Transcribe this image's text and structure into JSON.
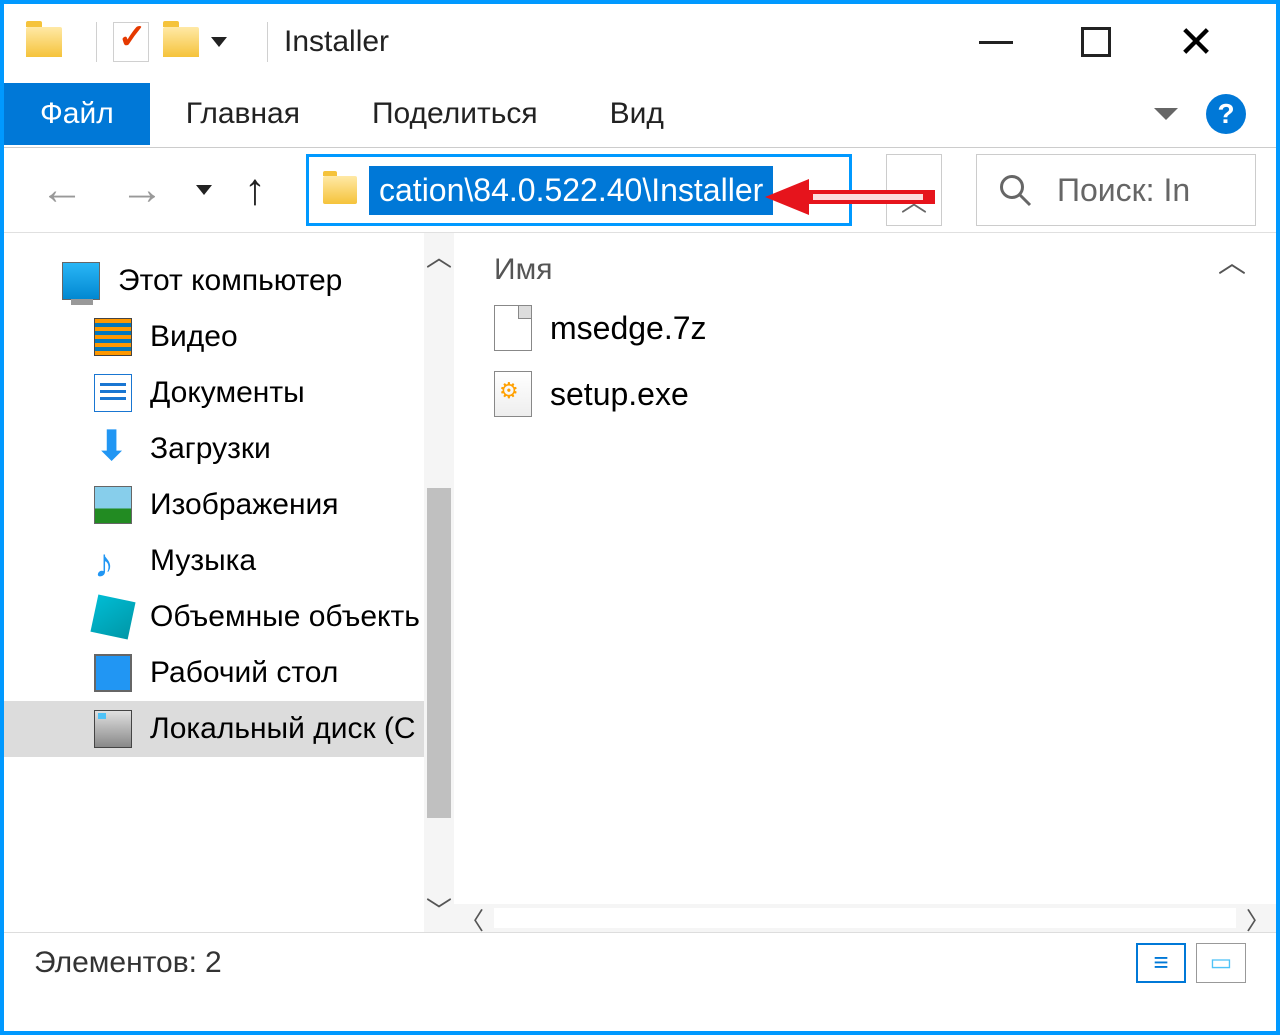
{
  "titlebar": {
    "title": "Installer"
  },
  "ribbon": {
    "tabs": [
      "Файл",
      "Главная",
      "Поделиться",
      "Вид"
    ],
    "active": "Файл"
  },
  "address": {
    "path": "cation\\84.0.522.40\\Installer"
  },
  "search": {
    "placeholder": "Поиск: In"
  },
  "sidebar": {
    "root": "Этот компьютер",
    "items": [
      "Видео",
      "Документы",
      "Загрузки",
      "Изображения",
      "Музыка",
      "Объемные объекть",
      "Рабочий стол",
      "Локальный диск (C"
    ]
  },
  "columns": {
    "name": "Имя"
  },
  "files": [
    {
      "name": "msedge.7z",
      "icon": "archive"
    },
    {
      "name": "setup.exe",
      "icon": "exe"
    }
  ],
  "status": {
    "count_label": "Элементов:",
    "count": "2"
  }
}
